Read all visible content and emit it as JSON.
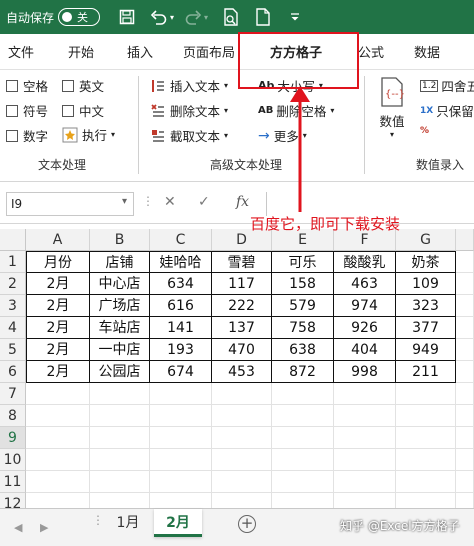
{
  "titlebar": {
    "autosave_label": "自动保存",
    "toggle_state": "关",
    "icons": [
      "save-icon",
      "undo-icon",
      "redo-icon",
      "print-preview-icon",
      "new-file-icon",
      "customize-icon"
    ]
  },
  "tabs": [
    "文件",
    "开始",
    "插入",
    "页面布局",
    "方方格子",
    "公式",
    "数据"
  ],
  "active_tab": "方方格子",
  "ribbon": {
    "text_group": {
      "label": "文本处理",
      "checkboxes": [
        "空格",
        "英文",
        "符号",
        "中文",
        "数字"
      ],
      "execute": "执行"
    },
    "advanced_group": {
      "label": "高级文本处理",
      "insert_text": "插入文本",
      "delete_text": "删除文本",
      "extract_text": "截取文本",
      "case": "大小写",
      "delete_space": "删除空格",
      "more": "更多"
    },
    "value_group": {
      "label": "数值录入",
      "value": "数值",
      "round": "四舍五",
      "only_keep": "只保留"
    }
  },
  "formula_bar": {
    "cell_ref": "I9",
    "cancel_symbol": "✕",
    "confirm_symbol": "✓",
    "fx_symbol": "fx"
  },
  "grid": {
    "columns": [
      "A",
      "B",
      "C",
      "D",
      "E",
      "F",
      "G"
    ],
    "rows": [
      "1",
      "2",
      "3",
      "4",
      "5",
      "6",
      "7",
      "8",
      "9",
      "10",
      "11",
      "12"
    ],
    "selected_row": "9",
    "data": [
      [
        "月份",
        "店铺",
        "娃哈哈",
        "雪碧",
        "可乐",
        "酸酸乳",
        "奶茶"
      ],
      [
        "2月",
        "中心店",
        "634",
        "117",
        "158",
        "463",
        "109"
      ],
      [
        "2月",
        "广场店",
        "616",
        "222",
        "579",
        "974",
        "323"
      ],
      [
        "2月",
        "车站店",
        "141",
        "137",
        "758",
        "926",
        "377"
      ],
      [
        "2月",
        "一中店",
        "193",
        "470",
        "638",
        "404",
        "949"
      ],
      [
        "2月",
        "公园店",
        "674",
        "453",
        "872",
        "998",
        "211"
      ]
    ]
  },
  "sheets": [
    "1月",
    "2月"
  ],
  "active_sheet": "2月",
  "watermark": "知乎 @Excel方方格子",
  "annotation": "百度它，即可下载安装",
  "colors": {
    "excel_green": "#217346",
    "annotation_red": "#e0141e"
  }
}
